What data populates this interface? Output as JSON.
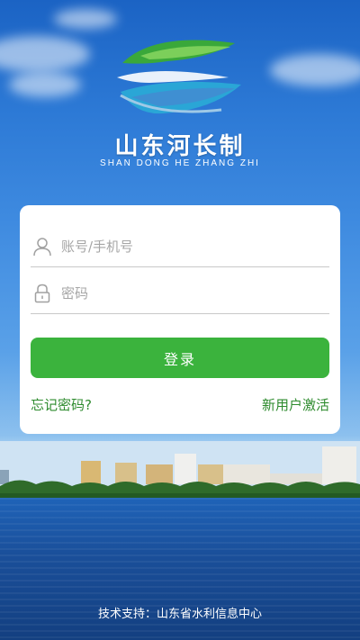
{
  "brand": {
    "title": "山东河长制",
    "subtitle": "SHAN DONG HE ZHANG ZHI"
  },
  "login": {
    "username_placeholder": "账号/手机号",
    "username_value": "",
    "password_placeholder": "密码",
    "password_value": "",
    "submit_label": "登录",
    "forgot_label": "忘记密码?",
    "activate_label": "新用户激活"
  },
  "footer": {
    "text": "技术支持：山东省水利信息中心"
  },
  "colors": {
    "primary_green": "#3bb33d",
    "link_green": "#2e8b2e",
    "sky_blue": "#2d7ad6"
  },
  "icons": {
    "user_field": "user-icon",
    "password_field": "lock-icon"
  }
}
